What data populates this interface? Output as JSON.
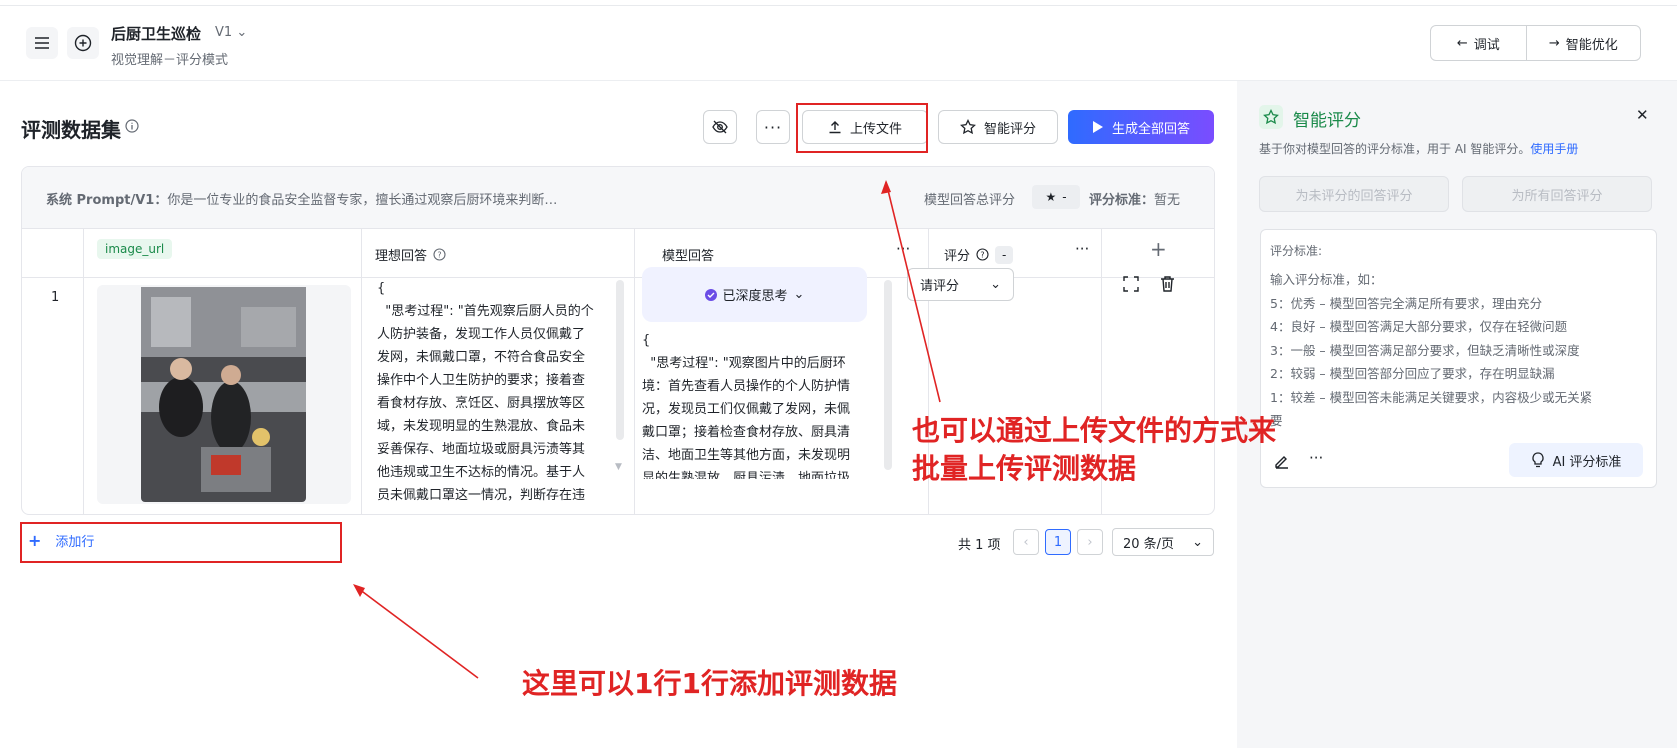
{
  "header": {
    "title": "后厨卫生巡检",
    "version": "V1",
    "subtitle": "视觉理解－评分模式",
    "debug_label": "调试",
    "optimize_label": "智能优化"
  },
  "section": {
    "title": "评测数据集",
    "upload_label": "上传文件",
    "smart_score_label": "智能评分",
    "generate_label": "生成全部回答"
  },
  "table": {
    "system_prompt_label": "系统 Prompt/V1：",
    "system_prompt_text": "你是一位专业的食品安全监督专家，擅长通过观察后厨环境来判断…",
    "total_score_label": "模型回答总评分",
    "total_score_value": "-",
    "criteria_label": "评分标准：",
    "criteria_value": "暂无",
    "columns": {
      "image": "image_url",
      "ideal": "理想回答",
      "model": "模型回答",
      "score": "评分",
      "score_badge": "-"
    },
    "rows": [
      {
        "index": "1",
        "ideal_lines": [
          "{",
          "  \"思考过程\": \"首先观察后厨人员的个",
          "人防护装备，发现工作人员仅佩戴了",
          "发网，未佩戴口罩，不符合食品安全",
          "操作中个人卫生防护的要求；接着查",
          "看食材存放、烹饪区、厨具摆放等区",
          "域，未发现明显的生熟混放、食品未",
          "妥善保存、地面垃圾或厨具污渍等其",
          "他违规或卫生不达标的情况。基于人",
          "员未佩戴口罩这一情况，判断存在违"
        ],
        "deep_think_label": "已深度思考",
        "model_lines": [
          "{",
          "  \"思考过程\": \"观察图片中的后厨环",
          "境：首先查看人员操作的个人防护情",
          "况，发现员工们仅佩戴了发网，未佩",
          "戴口罩；接着检查食材存放、厨具清",
          "洁、地面卫生等其他方面，未发现明",
          "显的生熟混放、厨具污渍、地面垃圾"
        ],
        "score_placeholder": "请评分"
      }
    ]
  },
  "add_row_label": "添加行",
  "pagination": {
    "total": "共 1 项",
    "current_page": "1",
    "page_size": "20 条/页"
  },
  "panel": {
    "title": "智能评分",
    "desc": "基于你对模型回答的评分标准，用于 AI 智能评分。",
    "manual_link": "使用手册",
    "btn_unscored": "为未评分的回答评分",
    "btn_all": "为所有回答评分",
    "criteria_heading": "评分标准:",
    "criteria_lines": [
      "输入评分标准，如：",
      "5：优秀 – 模型回答完全满足所有要求，理由充分",
      "4：良好 – 模型回答满足大部分要求，仅存在轻微问题",
      "3：一般 – 模型回答满足部分要求，但缺乏清晰性或深度",
      "2：较弱 – 模型回答部分回应了要求，存在明显缺漏",
      "1：较差 – 模型回答未能满足关键要求，内容极少或无关紧",
      "要"
    ],
    "ai_criteria_label": "AI 评分标准"
  },
  "annotations": {
    "upload_note_1": "也可以通过上传文件的方式来",
    "upload_note_2": "批量上传评测数据",
    "add_row_note": "这里可以1行1行添加评测数据"
  },
  "colors": {
    "primary": "#2f6bff",
    "annotation_red": "#e02424",
    "tag_green": "#1a8a4a"
  }
}
